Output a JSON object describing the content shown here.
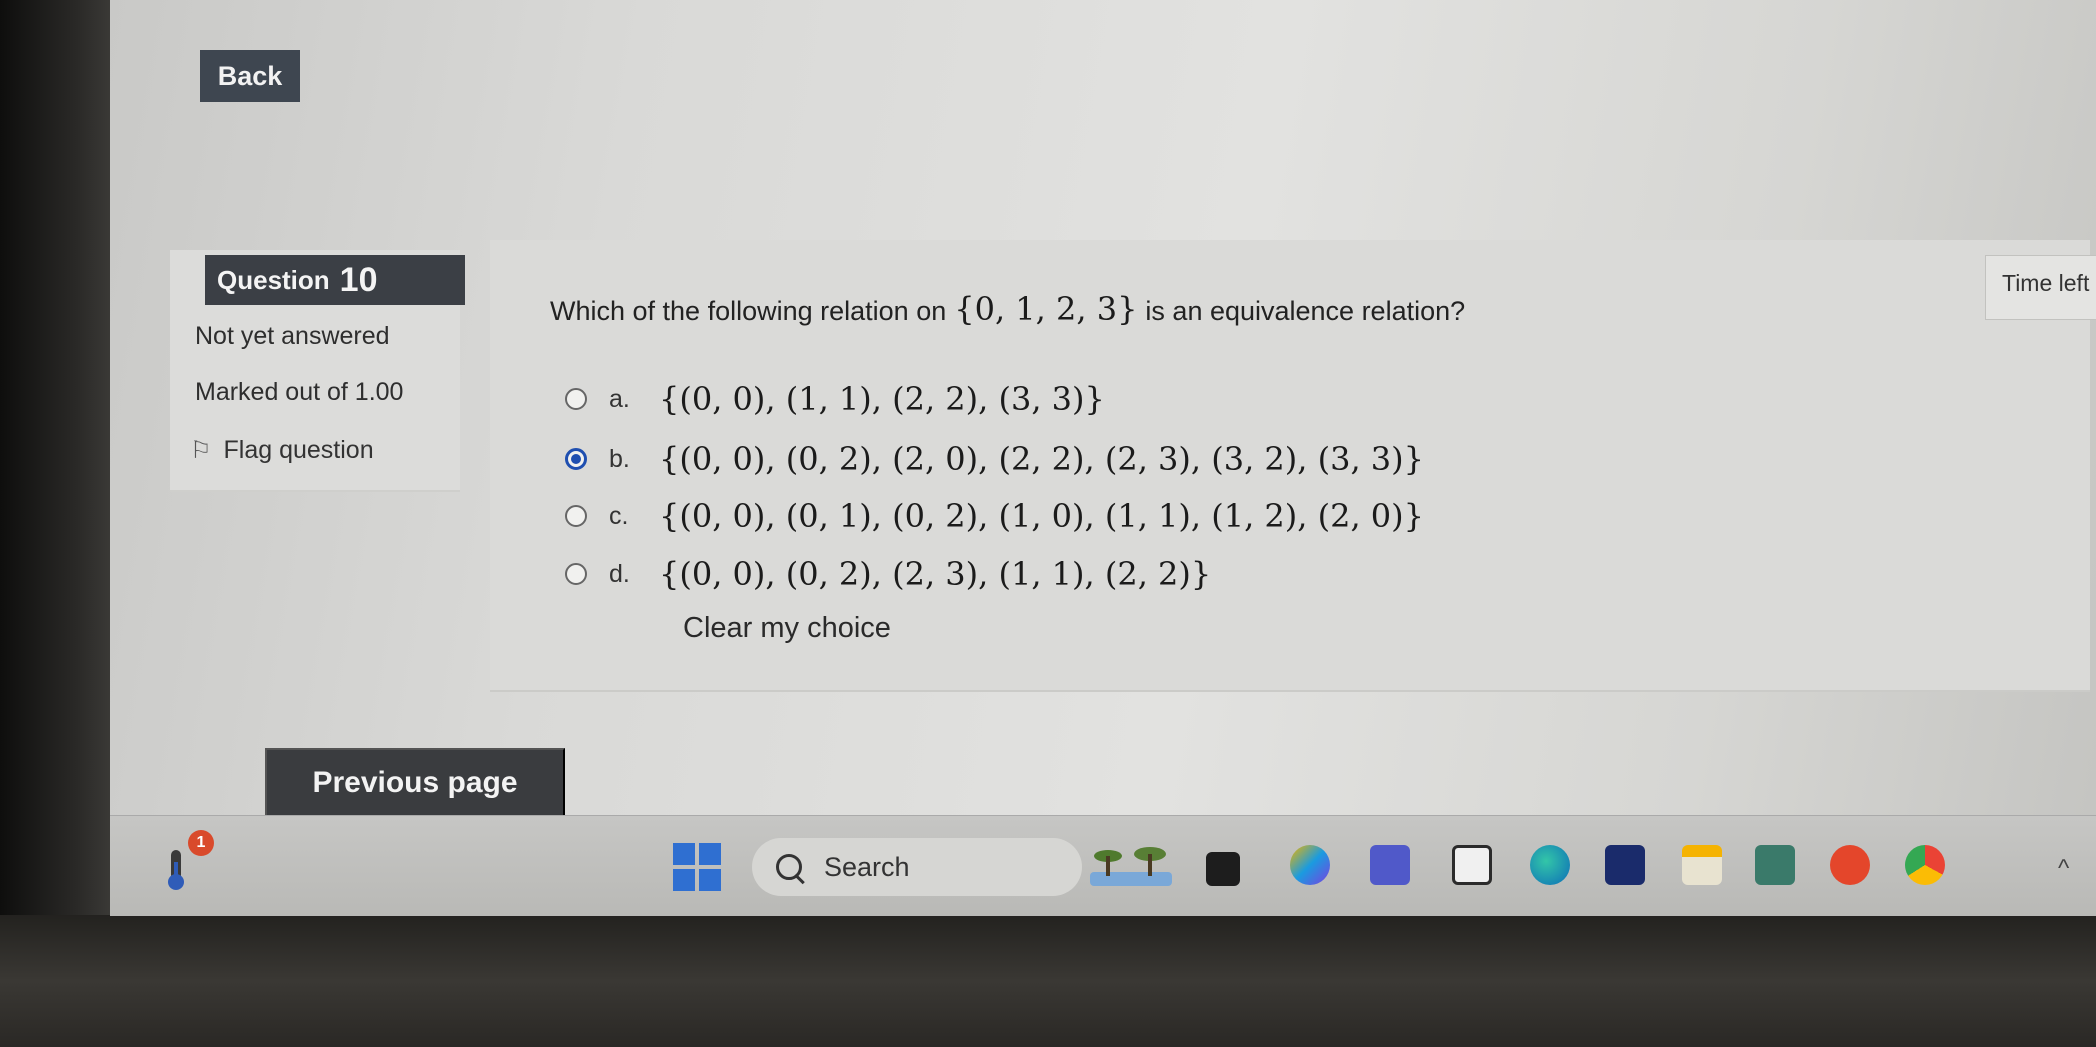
{
  "nav": {
    "back_label": "Back",
    "previous_label": "Previous page"
  },
  "question": {
    "label": "Question",
    "number": "10",
    "status": "Not yet answered",
    "marks": "Marked out of 1.00",
    "flag_label": "Flag question",
    "text_before": "Which of the following relation on",
    "text_set": "{0, 1, 2, 3}",
    "text_after": "is an equivalence relation?",
    "options": [
      {
        "letter": "a.",
        "value": "{(0, 0), (1, 1), (2, 2), (3, 3)}",
        "selected": false
      },
      {
        "letter": "b.",
        "value": "{(0, 0), (0, 2), (2, 0), (2, 2), (2, 3), (3, 2), (3, 3)}",
        "selected": true
      },
      {
        "letter": "c.",
        "value": "{(0, 0), (0, 1), (0, 2), (1, 0), (1, 1), (1, 2), (2, 0)}",
        "selected": false
      },
      {
        "letter": "d.",
        "value": "{(0, 0), (0, 2), (2, 3), (1, 1), (2, 2)}",
        "selected": false
      }
    ],
    "clear_label": "Clear my choice"
  },
  "timer": {
    "label": "Time left"
  },
  "taskbar": {
    "search_placeholder": "Search",
    "weather_badge": "1",
    "accent": "#2f6fd1"
  }
}
